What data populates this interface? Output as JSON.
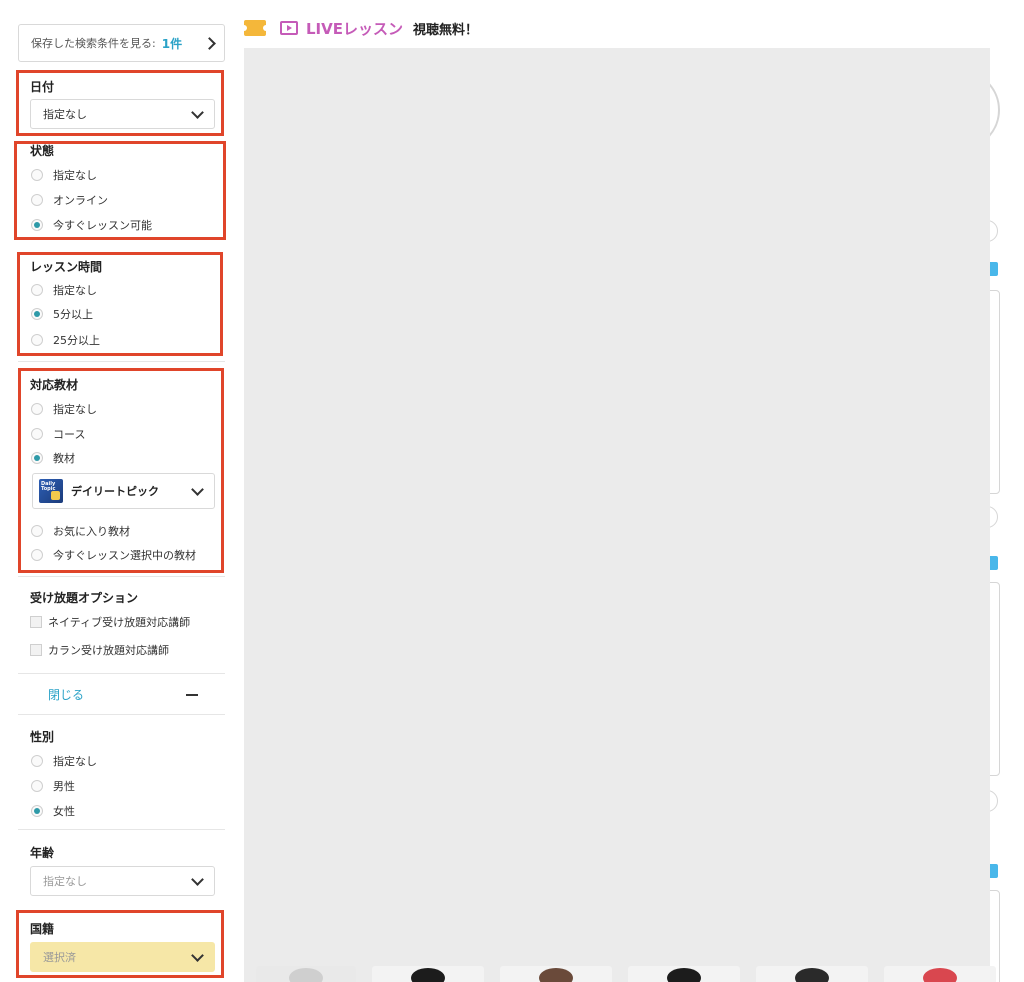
{
  "saved_search": {
    "label": "保存した検索条件を見る:",
    "count": "1件"
  },
  "date": {
    "title": "日付",
    "value": "指定なし"
  },
  "status": {
    "title": "状態",
    "options": [
      {
        "label": "指定なし",
        "selected": false
      },
      {
        "label": "オンライン",
        "selected": false
      },
      {
        "label": "今すぐレッスン可能",
        "selected": true
      }
    ]
  },
  "lesson_time": {
    "title": "レッスン時間",
    "options": [
      {
        "label": "指定なし",
        "selected": false
      },
      {
        "label": "5分以上",
        "selected": true
      },
      {
        "label": "25分以上",
        "selected": false
      }
    ]
  },
  "material": {
    "title": "対応教材",
    "options": [
      {
        "label": "指定なし",
        "selected": false
      },
      {
        "label": "コース",
        "selected": false
      },
      {
        "label": "教材",
        "selected": true
      },
      {
        "label": "お気に入り教材",
        "selected": false
      },
      {
        "label": "今すぐレッスン選択中の教材",
        "selected": false
      }
    ],
    "selected_material": "デイリートピック",
    "thumb_text": "Daily Topic"
  },
  "unlimited": {
    "title": "受け放題オプション",
    "options": [
      {
        "label": "ネイティブ受け放題対応講師",
        "checked": false
      },
      {
        "label": "カラン受け放題対応講師",
        "checked": false
      }
    ]
  },
  "close_label": "閉じる",
  "gender": {
    "title": "性別",
    "options": [
      {
        "label": "指定なし",
        "selected": false
      },
      {
        "label": "男性",
        "selected": false
      },
      {
        "label": "女性",
        "selected": true
      }
    ]
  },
  "age": {
    "title": "年齢",
    "value": "指定なし"
  },
  "nationality": {
    "title": "国籍",
    "value": "選択済"
  },
  "banner": {
    "live": "LIVEレッスン",
    "free": "視聴無料！"
  },
  "colors": {
    "accent_red": "#e0452a",
    "radio_on": "#2e9aa8",
    "link_blue": "#2aa2c7",
    "live_pink": "#c55bb8",
    "ticket_yellow": "#f4b73a"
  }
}
